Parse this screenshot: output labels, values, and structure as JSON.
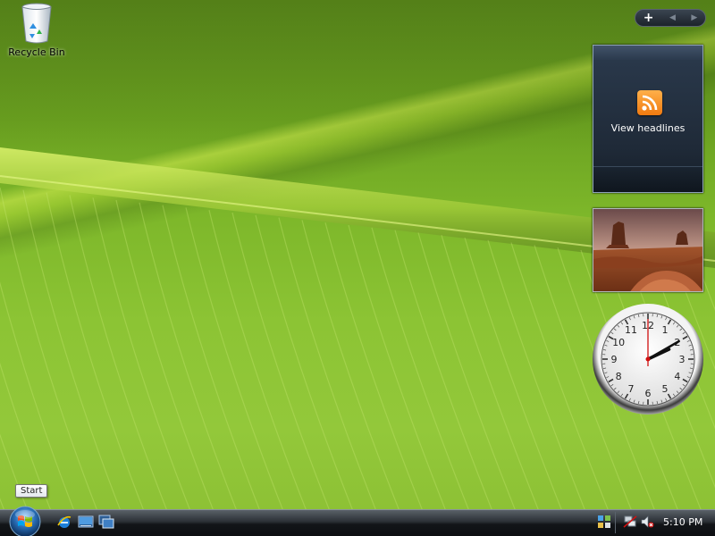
{
  "desktop": {
    "icons": [
      {
        "label": "Recycle Bin",
        "icon": "recycle-bin-icon"
      }
    ]
  },
  "sidebar": {
    "controls": {
      "add": "+",
      "prev": "◀",
      "next": "▶"
    },
    "feed_gadget": {
      "label": "View headlines",
      "icon": "rss-icon"
    },
    "slideshow_gadget": {
      "icon": "photo-icon"
    },
    "clock_gadget": {
      "numbers": [
        "12",
        "1",
        "2",
        "3",
        "4",
        "5",
        "6",
        "7",
        "8",
        "9",
        "10",
        "11"
      ],
      "time": {
        "hour": 2,
        "minute": 10,
        "second": 0
      }
    }
  },
  "taskbar": {
    "start_tooltip": "Start",
    "quick_launch": [
      {
        "icon": "internet-explorer-icon"
      },
      {
        "icon": "show-desktop-icon"
      },
      {
        "icon": "switch-windows-icon"
      }
    ],
    "tray": {
      "icons": [
        "windows-sidebar-icon",
        "network-icon",
        "volume-muted-icon"
      ],
      "time": "5:10 PM"
    }
  },
  "colors": {
    "leaf_light": "#93c83a",
    "leaf_dark": "#5f8c1e",
    "rss_orange": "#f07a10",
    "clock_hand_red": "#d01010"
  }
}
